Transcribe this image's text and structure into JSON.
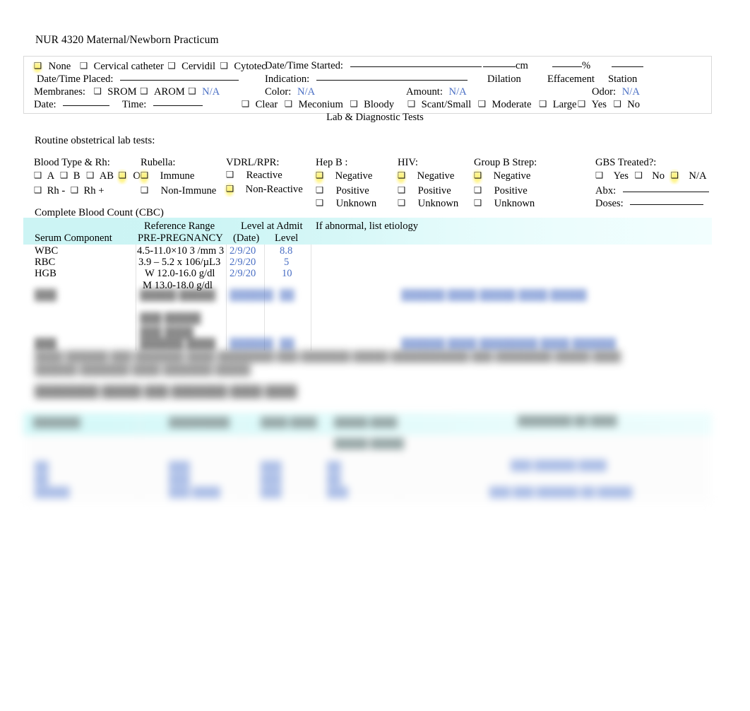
{
  "document": {
    "title": "NUR 4320 Maternal/Newborn Practicum"
  },
  "induction": {
    "options": [
      {
        "label": "None",
        "checked": true
      },
      {
        "label": "Cervical catheter",
        "checked": false
      },
      {
        "label": "Cervidil",
        "checked": false
      },
      {
        "label": "Cytotec",
        "checked": false
      }
    ],
    "date_time_placed_label": "Date/Time Placed:",
    "date_time_placed_value": "",
    "date_time_started_label": "Date/Time Started:",
    "date_time_started_value": "",
    "indication_label": "Indication:",
    "indication_value": ""
  },
  "exam": {
    "cm_suffix": "cm",
    "percent_suffix": "%",
    "dilation_label": "Dilation",
    "effacement_label": "Effacement",
    "station_label": "Station",
    "dilation_value": "",
    "effacement_value": "",
    "station_value": ""
  },
  "membranes": {
    "label": "Membranes:",
    "options": [
      {
        "label": "SROM",
        "checked": false
      },
      {
        "label": "AROM",
        "checked": false
      },
      {
        "label": "N/A",
        "checked": false,
        "blue": true
      }
    ],
    "date_label": "Date:",
    "date_value": "",
    "time_label": "Time:",
    "time_value": ""
  },
  "fluid": {
    "color_label": "Color:",
    "color_value": "N/A",
    "color_options": [
      "Clear",
      "Meconium",
      "Bloody"
    ],
    "amount_label": "Amount:",
    "amount_value": "N/A",
    "amount_options": [
      "Scant/Small",
      "Moderate",
      "Large"
    ],
    "odor_label": "Odor:",
    "odor_value": "N/A",
    "odor_options": [
      "Yes",
      "No"
    ]
  },
  "lab_section": {
    "banner": "Lab & Diagnostic Tests",
    "routine_label": "Routine obstetrical lab tests:",
    "columns": [
      {
        "header": "Blood Type & Rh:",
        "rows": [
          [
            {
              "label": "A",
              "checked": false
            },
            {
              "label": "B",
              "checked": false
            },
            {
              "label": "AB",
              "checked": false
            },
            {
              "label": "O",
              "checked": true
            }
          ],
          [
            {
              "label": "Rh -",
              "checked": false
            },
            {
              "label": "Rh +",
              "checked": false
            }
          ]
        ]
      },
      {
        "header": "Rubella:",
        "options": [
          {
            "label": "Immune",
            "checked": true
          },
          {
            "label": "Non-Immune",
            "checked": false
          }
        ]
      },
      {
        "header": "VDRL/RPR:",
        "options": [
          {
            "label": "Reactive",
            "checked": false
          },
          {
            "label": "Non-Reactive",
            "checked": true
          }
        ]
      },
      {
        "header": "Hep B :",
        "options": [
          {
            "label": "Negative",
            "checked": true
          },
          {
            "label": "Positive",
            "checked": false
          },
          {
            "label": "Unknown",
            "checked": false
          }
        ]
      },
      {
        "header": "HIV:",
        "options": [
          {
            "label": "Negative",
            "checked": true
          },
          {
            "label": "Positive",
            "checked": false
          },
          {
            "label": "Unknown",
            "checked": false
          }
        ]
      },
      {
        "header": "Group B Strep:",
        "options": [
          {
            "label": "Negative",
            "checked": true
          },
          {
            "label": "Positive",
            "checked": false
          },
          {
            "label": "Unknown",
            "checked": false
          }
        ]
      }
    ],
    "gbs_treated": {
      "header": "GBS Treated?:",
      "options": [
        {
          "label": "Yes",
          "checked": false
        },
        {
          "label": "No",
          "checked": false
        },
        {
          "label": "N/A",
          "checked": true
        }
      ],
      "abx_label": "Abx:",
      "abx_value": "",
      "doses_label": "Doses:",
      "doses_value": ""
    }
  },
  "cbc": {
    "title": "Complete Blood Count (CBC)",
    "headers": {
      "component": "Serum Component",
      "reference_range_l1": "Reference Range",
      "reference_range_l2": "PRE-PREGNANCY",
      "level_at_admit": "Level at Admit",
      "date": "(Date)",
      "level": "Level",
      "etiology": "If abnormal, list etiology"
    },
    "rows": [
      {
        "component": "WBC",
        "reference": "4.5-11.0×10 3 /mm 3",
        "reference2": "",
        "date": "2/9/20",
        "level": "8.8",
        "etiology": ""
      },
      {
        "component": "RBC",
        "reference": "3.9 – 5.2 x 106/µL3",
        "reference2": "",
        "date": "2/9/20",
        "level": "5",
        "etiology": ""
      },
      {
        "component": "HGB",
        "reference": "W 12.0-16.0 g/dl",
        "reference2": "M 13.0-18.0 g/dl",
        "date": "2/9/20",
        "level": "10",
        "etiology": ""
      }
    ],
    "redacted_rows": [
      {
        "component": "███",
        "reference": "█████ █████",
        "date": "██████",
        "level": "██",
        "etiology": "██████ ████ █████ ████ █████"
      },
      {
        "component": "",
        "reference": "███ █████",
        "date": "████",
        "level": "█",
        "etiology": "█████ ████ ██████ ███ ██████"
      },
      {
        "component": "",
        "reference": "███ ████",
        "date": "",
        "level": "",
        "etiology": ""
      },
      {
        "component": "███",
        "reference": "██████ ████",
        "date": "██████",
        "level": "██",
        "etiology": "██████ ████ ████████ ████ ██████"
      }
    ]
  },
  "redacted_paragraph": {
    "line1": "████ ██████ ███ ███████ ████ ████████ ███ ███████ █████ ███████████ ███ ████████ █████ ████",
    "line2": "██████ ███████ ████ ███████ █████",
    "heading": "████████ █████ ███ ███████ ████ ████"
  },
  "bottom_table": {
    "headers": [
      "███████",
      "█████████",
      "████ ████",
      "█████ ████",
      "████████ ██ ████"
    ],
    "subheaders": [
      "█",
      "",
      "",
      "█████   █████",
      ""
    ],
    "rows": [
      [
        "██",
        "███",
        "███",
        "██",
        "███ ██████ ████"
      ],
      [
        "██",
        "███",
        "███",
        "██",
        ""
      ],
      [
        "█████",
        "███ ████",
        "███",
        "███",
        "███ ███ ██████ ██ █████"
      ]
    ]
  },
  "colors": {
    "accent_teal_header": "#ccf4f4",
    "accent_cyan_header": "#aff2f2",
    "value_blue": "#4a6fc4",
    "highlight_yellow": "#fff16e",
    "border_gray": "#d9d9d9"
  }
}
